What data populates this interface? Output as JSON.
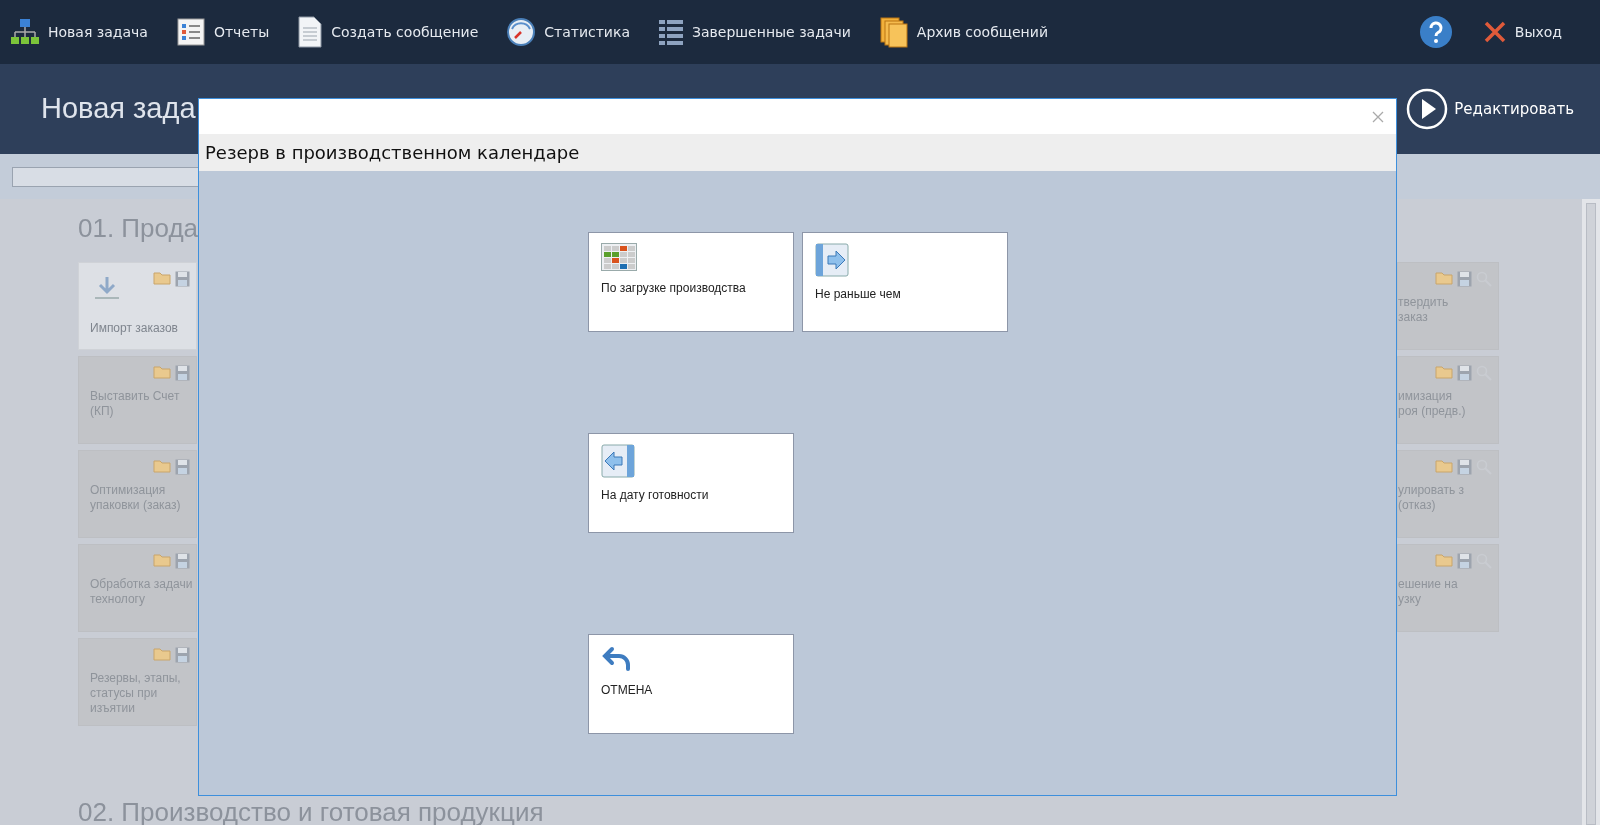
{
  "toolbar": {
    "items": [
      {
        "kind": "hierarchy",
        "label": "Новая задача"
      },
      {
        "kind": "checklist",
        "label": "Отчеты"
      },
      {
        "kind": "document",
        "label": "Создать сообщение"
      },
      {
        "kind": "gauge",
        "label": "Статистика"
      },
      {
        "kind": "list",
        "label": "Завершенные задачи"
      },
      {
        "kind": "archive",
        "label": "Архив сообщений"
      }
    ],
    "exit": {
      "label": "Выход"
    }
  },
  "header": {
    "title": "Новая зада",
    "action": "Редактировать"
  },
  "sections": [
    {
      "title": "01. Прода",
      "left_cards": [
        {
          "label": "Импорт заказов",
          "disabled": false
        },
        {
          "label": "Выставить Счет (КП)",
          "disabled": true
        },
        {
          "label": "Оптимизация упаковки (заказ)",
          "disabled": true
        },
        {
          "label": "Обработка задачи технологу",
          "disabled": true
        },
        {
          "label": "Резервы, этапы, статусы при изъятии",
          "disabled": true
        }
      ],
      "right_cards": [
        {
          "label": "твердить заказ",
          "disabled": true
        },
        {
          "label": "имизация роя (предв.)",
          "disabled": true
        },
        {
          "label": "улировать з (отказ)",
          "disabled": true
        },
        {
          "label": "ешение на узку",
          "disabled": true
        }
      ]
    },
    {
      "title": "02. Производство и готовая продукция"
    }
  ],
  "dialog": {
    "title": "Резерв в производственном календаре",
    "option_rows": [
      [
        {
          "kind": "calendar",
          "label": "По загрузке производства"
        },
        {
          "kind": "forward",
          "label": "Не раньше чем"
        }
      ],
      [
        {
          "kind": "backward",
          "label": "На дату готовности"
        }
      ],
      [
        {
          "kind": "undo",
          "label": "ОТМЕНА"
        }
      ]
    ]
  }
}
